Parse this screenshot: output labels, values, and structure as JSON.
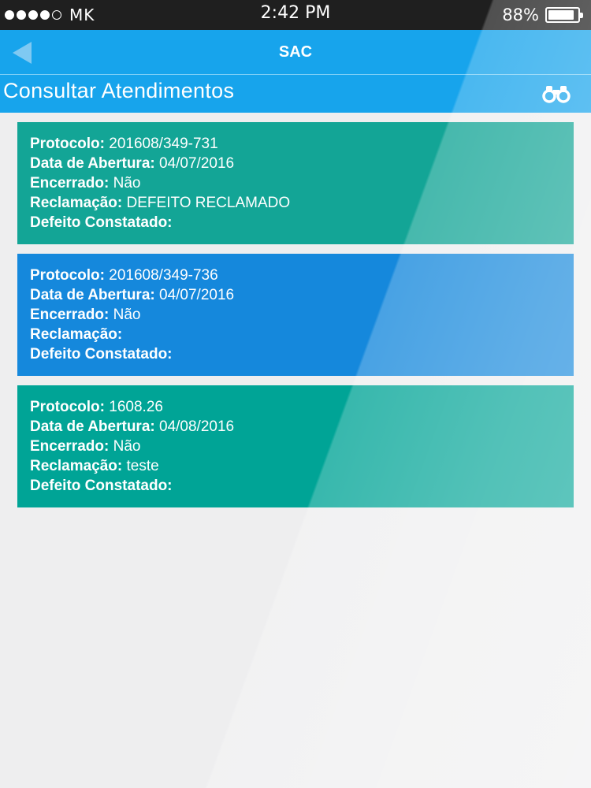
{
  "status_bar": {
    "carrier": "MK",
    "time": "2:42 PM",
    "battery_percent": "88%",
    "battery_level": 0.88
  },
  "header": {
    "title": "SAC",
    "back_icon": "back-arrow-icon"
  },
  "subheader": {
    "title": "Consultar Atendimentos",
    "search_icon": "binoculars-icon"
  },
  "labels": {
    "protocolo": "Protocolo:",
    "data_abertura": "Data de Abertura:",
    "encerrado": "Encerrado:",
    "reclamacao": "Reclamação:",
    "defeito_constatado": "Defeito Constatado:"
  },
  "cards": [
    {
      "color": "#13a596",
      "protocolo": "201608/349-731",
      "data_abertura": "04/07/2016",
      "encerrado": "Não",
      "reclamacao": "DEFEITO RECLAMADO",
      "defeito_constatado": ""
    },
    {
      "color": "#1588dc",
      "protocolo": "201608/349-736",
      "data_abertura": "04/07/2016",
      "encerrado": "Não",
      "reclamacao": "",
      "defeito_constatado": ""
    },
    {
      "color": "#00a496",
      "protocolo": "1608.26",
      "data_abertura": "04/08/2016",
      "encerrado": "Não",
      "reclamacao": "teste",
      "defeito_constatado": ""
    }
  ]
}
